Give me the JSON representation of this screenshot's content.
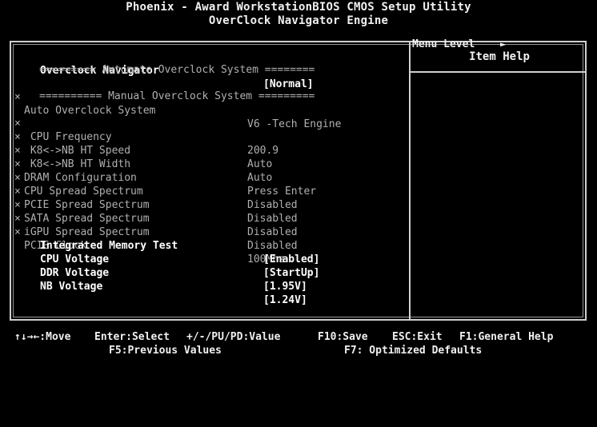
{
  "header": {
    "title_line1": "Phoenix - Award WorkstationBIOS CMOS Setup Utility",
    "title_line2": "OverClock Navigator Engine"
  },
  "settings": {
    "overclock_navigator": {
      "label": "Overclock Navigator",
      "value": "[Normal]"
    },
    "sep_auto": "========= Automate Overclock System ========",
    "auto_overclock_system": {
      "mark": "×",
      "label": "Auto Overclock System",
      "value": "V6 -Tech Engine"
    },
    "sep_manual": "========== Manual Overclock System =========",
    "cpu_frequency": {
      "mark": "×",
      "label": " CPU Frequency",
      "value": "200.9"
    },
    "k8_nb_ht_speed": {
      "mark": "×",
      "label": " K8<->NB HT Speed",
      "value": "Auto"
    },
    "k8_nb_ht_width": {
      "mark": "×",
      "label": " K8<->NB HT Width",
      "value": "Auto"
    },
    "dram_configuration": {
      "mark": "×",
      "label": "DRAM Configuration",
      "value": "Press Enter"
    },
    "cpu_spread_spectrum": {
      "mark": "×",
      "label": "CPU Spread Spectrum",
      "value": "Disabled"
    },
    "pcie_spread_spectrum": {
      "mark": "×",
      "label": "PCIE Spread Spectrum",
      "value": "Disabled"
    },
    "sata_spread_spectrum": {
      "mark": "×",
      "label": "SATA Spread Spectrum",
      "value": "Disabled"
    },
    "igpu_spread_spectrum": {
      "mark": "×",
      "label": "iGPU Spread Spectrum",
      "value": "Disabled"
    },
    "pcie_clock": {
      "mark": "×",
      "label": "PCIE Clock",
      "value": "100Mhz"
    },
    "integrated_memory_test": {
      "label": "Integrated Memory Test",
      "value": "[Enabled]"
    },
    "cpu_voltage": {
      "label": "CPU Voltage",
      "value": "[StartUp]"
    },
    "ddr_voltage": {
      "label": "DDR Voltage",
      "value": "[1.95V]"
    },
    "nb_voltage": {
      "label": "NB Voltage",
      "value": "[1.24V]"
    }
  },
  "help": {
    "title": "Item Help",
    "menu_level": "Menu Level",
    "menu_level_arrow": "►"
  },
  "footer": {
    "move": "↑↓→←:Move",
    "select": "Enter:Select",
    "value": "+/-/PU/PD:Value",
    "save": "F10:Save",
    "exit": "ESC:Exit",
    "general_help": "F1:General Help",
    "previous_values": "F5:Previous Values",
    "optimized_defaults": "F7: Optimized Defaults"
  }
}
